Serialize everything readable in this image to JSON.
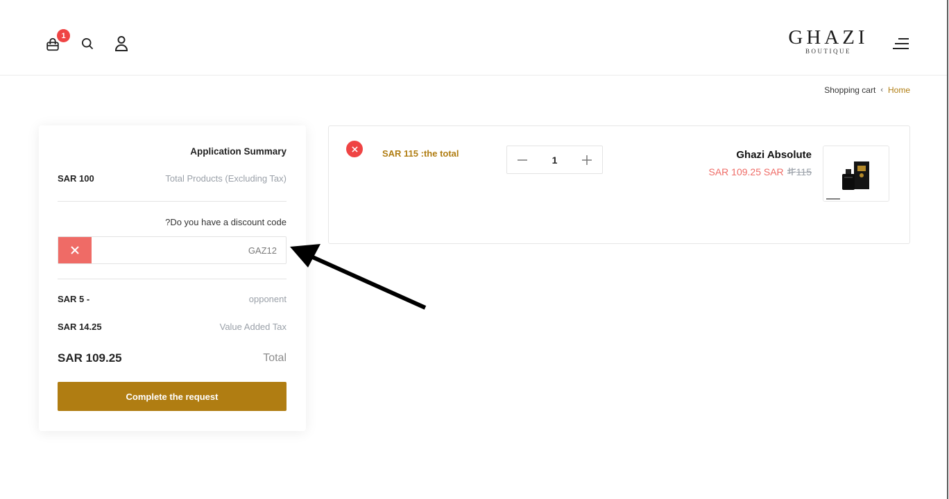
{
  "header": {
    "cart_badge_count": "1",
    "cart_icon": "shopping-bag-icon",
    "search_icon": "search-icon",
    "user_icon": "user-icon",
    "logo_main": "GHAZI",
    "logo_sub": "BOUTIQUE",
    "menu_icon": "hamburger-menu-icon"
  },
  "breadcrumb": {
    "current": "Shopping cart",
    "separator": "‹",
    "home": "Home"
  },
  "summary": {
    "title": "Application Summary",
    "products_value": "SAR 100",
    "products_label": "Total Products (Excluding Tax)",
    "discount_question": "?Do you have a discount code",
    "discount_code": "GAZ12",
    "remove_code_icon": "close-icon",
    "opponent_value": "SAR 5 -",
    "opponent_label": "opponent",
    "vat_value": "SAR 14.25",
    "vat_label": "Value Added Tax",
    "total_value": "SAR 109.25",
    "total_label": "Total",
    "complete_button": "Complete the request"
  },
  "cart_item": {
    "remove_icon": "close-icon",
    "total_text": "SAR 115 :the total",
    "quantity": "1",
    "minus_icon": "minus-icon",
    "plus_icon": "plus-icon",
    "name": "Ghazi Absolute",
    "price_new": "SAR 109.25 SAR",
    "price_old": "115",
    "currency_icon": "riyal-currency-icon"
  },
  "colors": {
    "accent_gold": "#b07d12",
    "danger_red": "#ef4444",
    "discount_red": "#ef6b66"
  }
}
